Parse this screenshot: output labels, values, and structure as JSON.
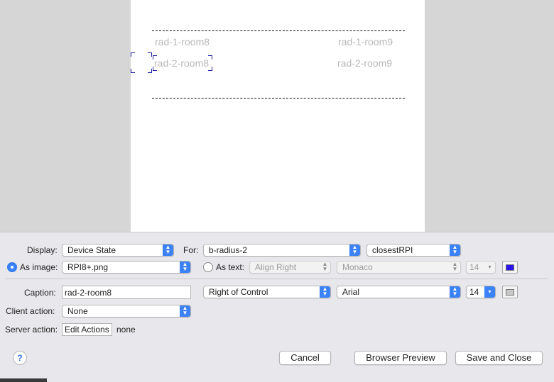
{
  "canvas": {
    "labels": {
      "room8_row1": "rad-1-room8",
      "room9_row1": "rad-1-room9",
      "room8_row2": "rad-2-room8",
      "room9_row2": "rad-2-room9"
    }
  },
  "inspector": {
    "display_label": "Display:",
    "display_value": "Device State",
    "for_label": "For:",
    "for_device": "b-radius-2",
    "for_state": "closestRPI",
    "as_image_label": "As image:",
    "image_value": "RPI8+.png",
    "as_text_label": "As text:",
    "text_align": "Align Right",
    "text_font": "Monaco",
    "text_size": "14",
    "text_color": "#2a12ee",
    "caption_label": "Caption:",
    "caption_value": "rad-2-room8",
    "caption_position": "Right of Control",
    "caption_font": "Arial",
    "caption_size": "14",
    "caption_color": "#c8c8c8",
    "client_action_label": "Client action:",
    "client_action_value": "None",
    "server_action_label": "Server action:",
    "edit_actions_label": "Edit Actions",
    "server_action_value": "none",
    "help_label": "?",
    "cancel_label": "Cancel",
    "browser_preview_label": "Browser Preview",
    "save_close_label": "Save and Close"
  },
  "colors": {
    "accent": "#3b82f6",
    "selection_handle": "#2020a0"
  }
}
